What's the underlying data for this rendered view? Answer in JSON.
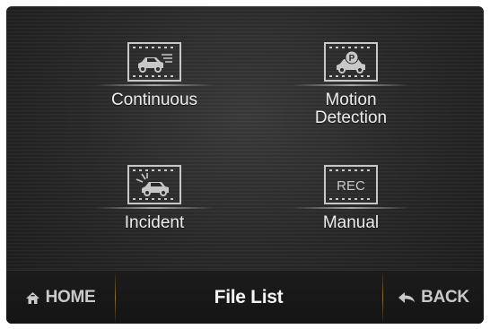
{
  "menu": {
    "continuous": {
      "label": "Continuous",
      "icon": "car-speed-icon"
    },
    "motion": {
      "label": "Motion\nDetection",
      "icon": "car-parking-icon"
    },
    "incident": {
      "label": "Incident",
      "icon": "car-impact-icon"
    },
    "manual": {
      "label": "Manual",
      "icon": "rec-icon",
      "icon_text": "REC"
    }
  },
  "bottom_bar": {
    "home_label": "HOME",
    "title": "File List",
    "back_label": "BACK"
  },
  "colors": {
    "icon_stroke": "#c8c8c8",
    "divider": "#8a6a2c",
    "text": "#ececec"
  }
}
